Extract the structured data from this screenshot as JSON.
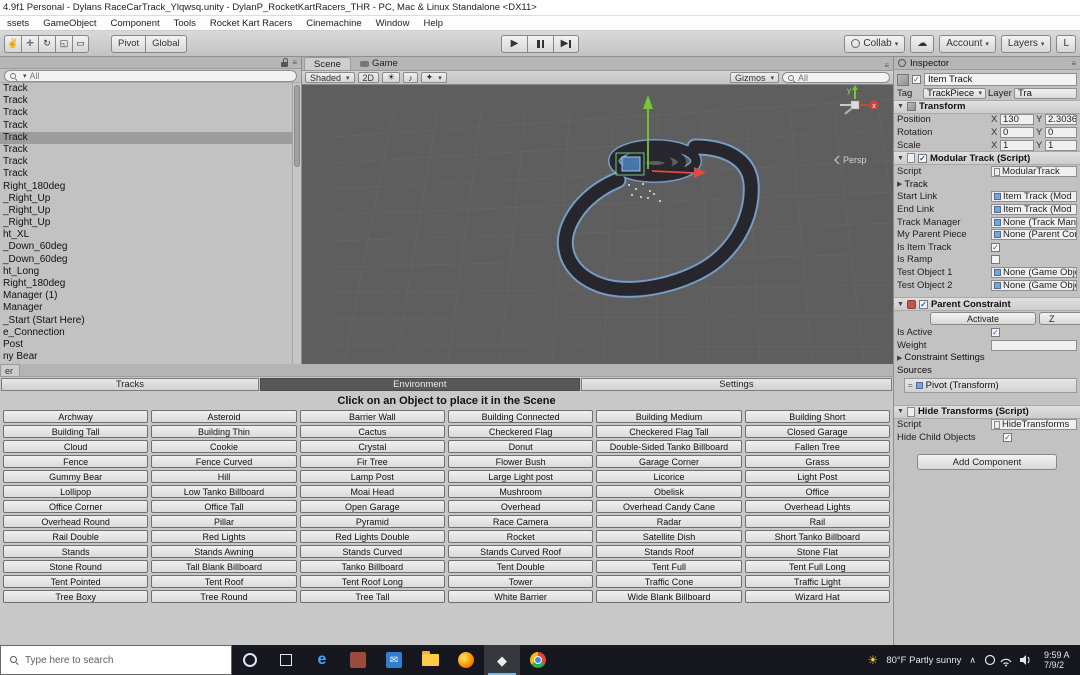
{
  "window": {
    "title": "4.9f1 Personal - Dylans RaceCarTrack_Ylqwsq.unity - DylanP_RocketKartRacers_THR - PC, Mac & Linux Standalone <DX11>"
  },
  "menu": {
    "items": [
      "ssets",
      "GameObject",
      "Component",
      "Tools",
      "Rocket Kart Racers",
      "Cinemachine",
      "Window",
      "Help"
    ]
  },
  "toolbar": {
    "pivot": "Pivot",
    "global": "Global",
    "collab": "Collab",
    "account": "Account",
    "layers": "Layers",
    "layout": "L"
  },
  "hierarchy": {
    "search_text": "All",
    "items": [
      {
        "label": "Track"
      },
      {
        "label": "Track"
      },
      {
        "label": "Track"
      },
      {
        "label": "Track"
      },
      {
        "label": "Track",
        "selected": true
      },
      {
        "label": "Track"
      },
      {
        "label": "Track"
      },
      {
        "label": "Track"
      },
      {
        "label": "Right_180deg"
      },
      {
        "label": "_Right_Up"
      },
      {
        "label": "_Right_Up"
      },
      {
        "label": "_Right_Up"
      },
      {
        "label": "ht_XL"
      },
      {
        "label": "_Down_60deg"
      },
      {
        "label": "_Down_60deg"
      },
      {
        "label": "ht_Long"
      },
      {
        "label": "Right_180deg"
      },
      {
        "label": "Manager (1)"
      },
      {
        "label": "Manager"
      },
      {
        "label": "_Start (Start Here)"
      },
      {
        "label": "e_Connection"
      },
      {
        "label": "Post"
      },
      {
        "label": "ny Bear"
      }
    ]
  },
  "scene": {
    "tab_scene": "Scene",
    "tab_game": "Game",
    "shading": "Shaded",
    "toggle_2d": "2D",
    "gizmos": "Gizmos",
    "search_text": "All",
    "persp": "Persp",
    "axis_x": "x",
    "axis_y": "y"
  },
  "inspector": {
    "tab": "Inspector",
    "name": "Item Track",
    "tag_label": "Tag",
    "tag": "TrackPiece",
    "layer_label": "Layer",
    "layer": "Tra",
    "transform": {
      "title": "Transform",
      "x": "X",
      "y": "Y",
      "rows": [
        {
          "label": "Position",
          "xv": "130",
          "yv": "2.3036"
        },
        {
          "label": "Rotation",
          "xv": "0",
          "yv": "0"
        },
        {
          "label": "Scale",
          "xv": "1",
          "yv": "1"
        }
      ]
    },
    "modular": {
      "title": "Modular Track (Script)",
      "script_label": "Script",
      "script_value": "ModularTrack",
      "track_foldout": "Track",
      "object_rows": [
        {
          "label": "Start Link",
          "value": "Item Track (Mod"
        },
        {
          "label": "End Link",
          "value": "Item Track (Mod"
        },
        {
          "label": "Track Manager",
          "value": "None (Track Mana"
        },
        {
          "label": "My Parent Piece",
          "value": "None (Parent Cons"
        }
      ],
      "check_rows": [
        {
          "label": "Is Item Track",
          "selected": true
        },
        {
          "label": "Is Ramp"
        }
      ],
      "test_rows": [
        {
          "label": "Test Object 1",
          "value": "None (Game Obje"
        },
        {
          "label": "Test Object 2",
          "value": "None (Game Obje"
        }
      ]
    },
    "constraint": {
      "title": "Parent Constraint",
      "activate": "Activate",
      "zero": "Z",
      "is_active": "Is Active",
      "weight": "Weight",
      "settings": "Constraint Settings",
      "sources": "Sources",
      "source_item": "Pivot (Transform)"
    },
    "hide": {
      "title": "Hide Transforms (Script)",
      "script_label": "Script",
      "script_value": "HideTransforms",
      "hide_children": "Hide Child Objects"
    },
    "add_component": "Add Component"
  },
  "placer": {
    "partial_tab": "er",
    "tabs": [
      {
        "label": "Tracks"
      },
      {
        "label": "Environment",
        "selected": true
      },
      {
        "label": "Settings"
      }
    ],
    "instruction": "Click on an Object to place it in the Scene",
    "objects": [
      "Archway",
      "Asteroid",
      "Barrier Wall",
      "Building Connected",
      "Building Medium",
      "Building Short",
      "Building Tall",
      "Building Thin",
      "Cactus",
      "Checkered Flag",
      "Checkered Flag Tall",
      "Closed Garage",
      "Cloud",
      "Cookie",
      "Crystal",
      "Donut",
      "Double-Sided Tanko Billboard",
      "Fallen Tree",
      "Fence",
      "Fence Curved",
      "Fir Tree",
      "Flower Bush",
      "Garage Corner",
      "Grass",
      "Gummy Bear",
      "Hill",
      "Lamp Post",
      "Large Light post",
      "Licorice",
      "Light Post",
      "Lollipop",
      "Low Tanko Billboard",
      "Moai Head",
      "Mushroom",
      "Obelisk",
      "Office",
      "Office Corner",
      "Office Tall",
      "Open Garage",
      "Overhead",
      "Overhead Candy Cane",
      "Overhead Lights",
      "Overhead Round",
      "Pillar",
      "Pyramid",
      "Race Camera",
      "Radar",
      "Rail",
      "Rail Double",
      "Red Lights",
      "Red Lights Double",
      "Rocket",
      "Satellite Dish",
      "Short Tanko Billboard",
      "Stands",
      "Stands Awning",
      "Stands Curved",
      "Stands Curved Roof",
      "Stands Roof",
      "Stone Flat",
      "Stone Round",
      "Tall Blank Billboard",
      "Tanko Billboard",
      "Tent Double",
      "Tent Full",
      "Tent Full Long",
      "Tent Pointed",
      "Tent Roof",
      "Tent Roof Long",
      "Tower",
      "Traffic Cone",
      "Traffic Light",
      "Tree Boxy",
      "Tree Round",
      "Tree Tall",
      "White Barrier",
      "Wide Blank Billboard",
      "Wizard Hat"
    ]
  },
  "taskbar": {
    "search_placeholder": "Type here to search",
    "weather": "80°F  Partly sunny",
    "time": "9:59 A",
    "date": "7/9/2"
  },
  "icons": {
    "hand": "✌",
    "move": "✛",
    "rotate": "↻",
    "scale": "◱",
    "rect": "▭",
    "play": "▶",
    "dropdown": "▾",
    "foldout_open": "▼",
    "foldout_closed": "▶",
    "menu": "≡",
    "sun": "☀",
    "audio": "♪",
    "effects": "✦",
    "cloud": "☁",
    "chevron_up": "∧",
    "edge": "e",
    "mail": "✉",
    "unity": "◆",
    "handle": "="
  }
}
